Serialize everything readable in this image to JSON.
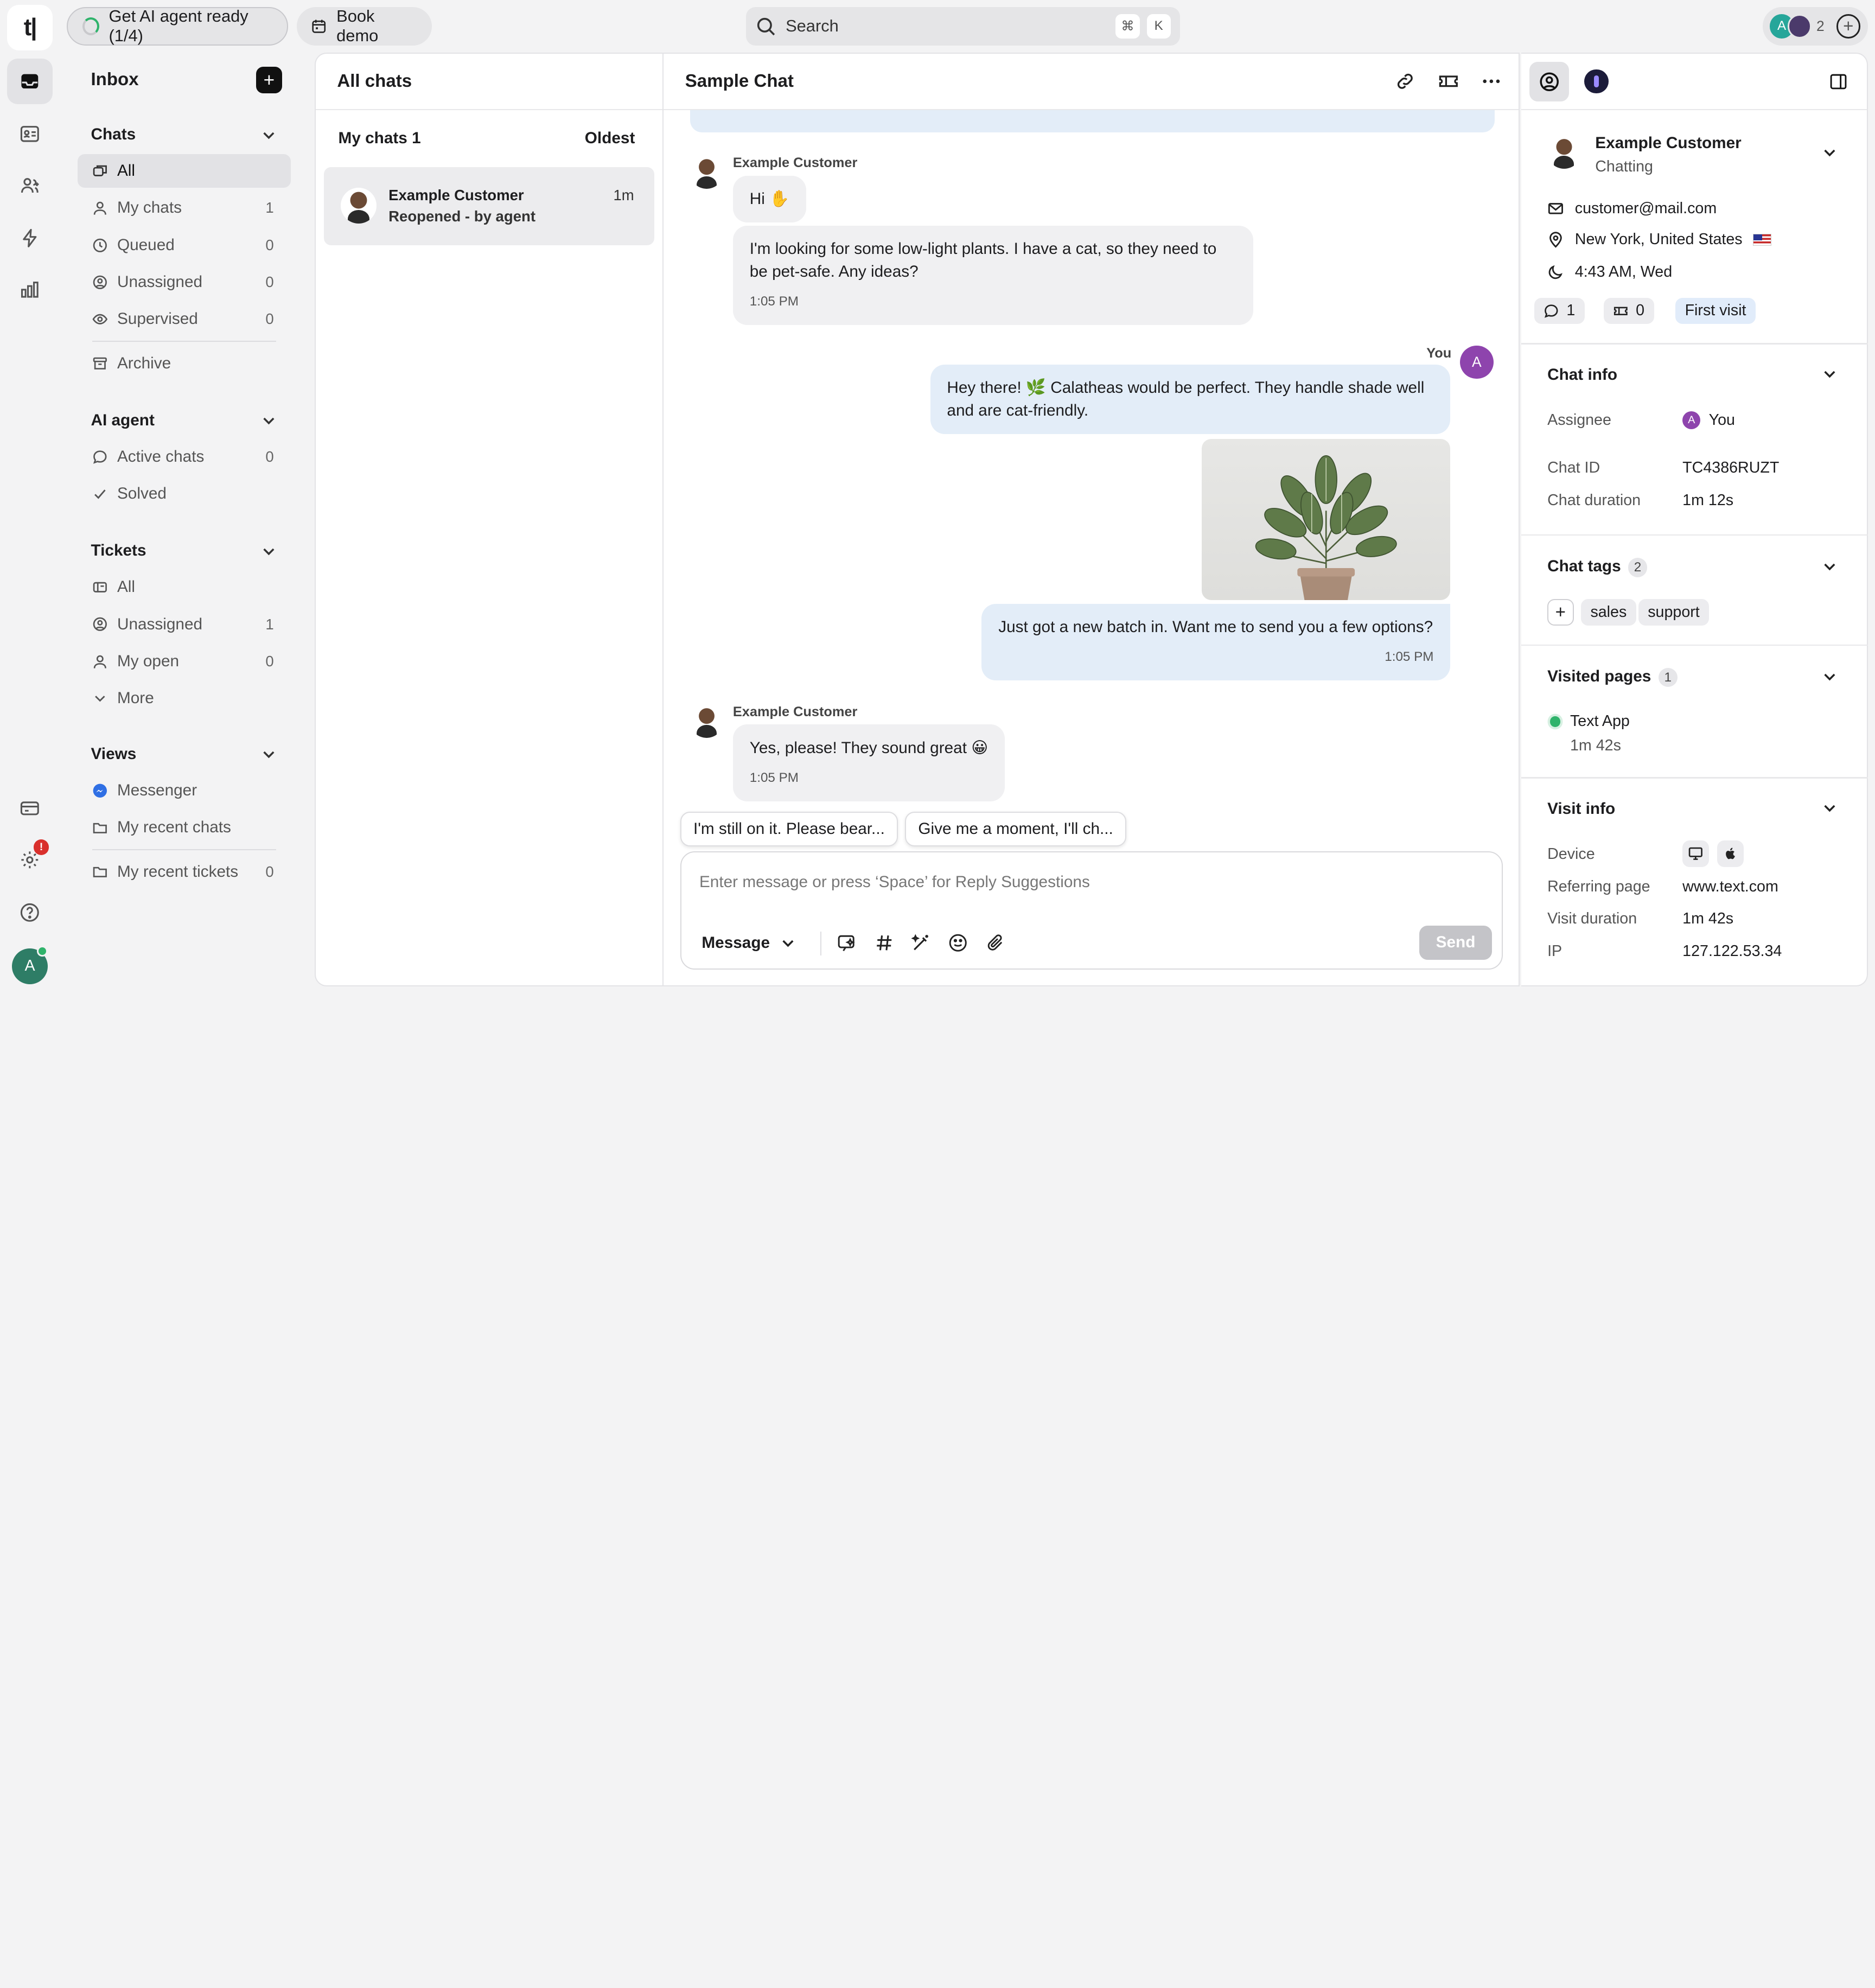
{
  "topbar": {
    "logo": "t|",
    "agent_ready": "Get AI agent ready (1/4)",
    "book_demo": "Book demo",
    "search_placeholder": "Search",
    "kbd_cmd": "⌘",
    "kbd_k": "K",
    "avatar_initial": "A",
    "agent_count": "2"
  },
  "nav": {
    "title": "Inbox",
    "sections": {
      "chats": {
        "title": "Chats",
        "items": [
          {
            "label": "All",
            "count": ""
          },
          {
            "label": "My chats",
            "count": "1"
          },
          {
            "label": "Queued",
            "count": "0"
          },
          {
            "label": "Unassigned",
            "count": "0"
          },
          {
            "label": "Supervised",
            "count": "0"
          }
        ],
        "archive": "Archive"
      },
      "ai_agent": {
        "title": "AI agent",
        "items": [
          {
            "label": "Active chats",
            "count": "0"
          },
          {
            "label": "Solved",
            "count": ""
          }
        ]
      },
      "tickets": {
        "title": "Tickets",
        "items": [
          {
            "label": "All",
            "count": ""
          },
          {
            "label": "Unassigned",
            "count": "1"
          },
          {
            "label": "My open",
            "count": "0"
          },
          {
            "label": "More",
            "count": ""
          }
        ]
      },
      "views": {
        "title": "Views",
        "items": [
          {
            "label": "Messenger",
            "count": ""
          },
          {
            "label": "My recent chats",
            "count": ""
          },
          {
            "label": "My recent tickets",
            "count": "0"
          }
        ]
      }
    },
    "settings_badge": "!",
    "me_initial": "A"
  },
  "chat_list": {
    "title": "All chats",
    "group": "My chats 1",
    "sort": "Oldest",
    "items": [
      {
        "name": "Example Customer",
        "status": "Reopened - by agent",
        "time": "1m"
      }
    ]
  },
  "chat": {
    "title": "Sample Chat",
    "messages": [
      {
        "sender": "Example Customer",
        "text": "Hi ✋"
      },
      {
        "text": "I'm looking for some low-light plants. I have a cat, so they need to be pet-safe. Any ideas?",
        "time": "1:05 PM"
      },
      {
        "sender": "You",
        "text": "Hey there! 🌿 Calatheas would be perfect. They handle shade well and are cat-friendly."
      },
      {
        "text": "Just got a new batch in. Want me to send you a few options?",
        "time": "1:05 PM"
      },
      {
        "sender": "Example Customer",
        "text": "Yes, please! They sound great 😀",
        "time": "1:05 PM"
      }
    ],
    "you_initial": "A",
    "suggestions": [
      "I'm still on it. Please bear...",
      "Give me a moment, I'll ch..."
    ],
    "composer": {
      "placeholder": "Enter message or press ‘Space’ for Reply Suggestions",
      "type_label": "Message",
      "send_label": "Send"
    }
  },
  "customer": {
    "name": "Example Customer",
    "state": "Chatting",
    "email": "customer@mail.com",
    "location": "New York, United States",
    "local_time": "4:43 AM, Wed",
    "chats_count": "1",
    "tickets_count": "0",
    "visit_tag": "First visit"
  },
  "chat_info": {
    "title": "Chat info",
    "assignee_label": "Assignee",
    "assignee_initial": "A",
    "assignee_value": "You",
    "chat_id_label": "Chat ID",
    "chat_id_value": "TC4386RUZT",
    "duration_label": "Chat duration",
    "duration_value": "1m 12s"
  },
  "chat_tags": {
    "title": "Chat tags",
    "count": "2",
    "tags": [
      "sales",
      "support"
    ]
  },
  "visited_pages": {
    "title": "Visited pages",
    "count": "1",
    "page_name": "Text App",
    "page_time": "1m 42s"
  },
  "visit_info": {
    "title": "Visit info",
    "device_label": "Device",
    "referrer_label": "Referring page",
    "referrer_value": "www.text.com",
    "visit_duration_label": "Visit duration",
    "visit_duration_value": "1m 42s",
    "ip_label": "IP",
    "ip_value": "127.122.53.34"
  },
  "colors": {
    "accent_blue": "#e3edf8",
    "you_avatar": "#8e44ad",
    "online": "#2fb36b",
    "alert": "#d9302c"
  }
}
